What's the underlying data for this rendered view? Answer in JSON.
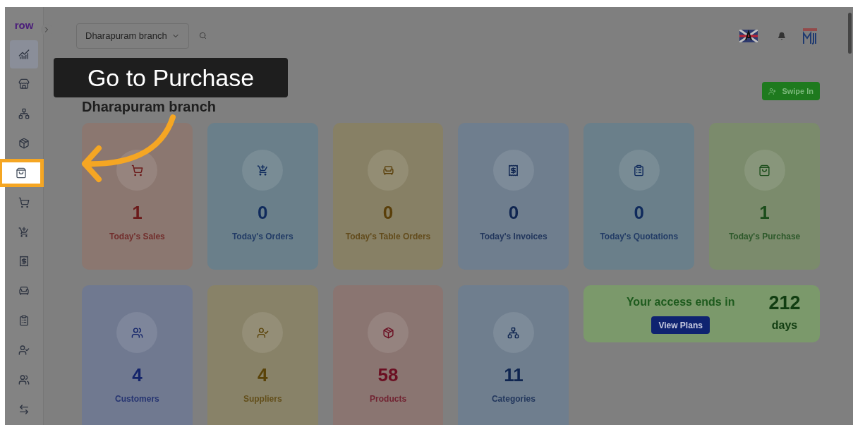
{
  "tooltip": {
    "text": "Go to Purchase"
  },
  "sidebar": {
    "logo": "row",
    "items": [
      {
        "kind": "chart",
        "selected": true,
        "highlighted": false
      },
      {
        "kind": "store",
        "selected": false,
        "highlighted": false
      },
      {
        "kind": "tree",
        "selected": false,
        "highlighted": false
      },
      {
        "kind": "box",
        "selected": false,
        "highlighted": false
      },
      {
        "kind": "bag",
        "selected": false,
        "highlighted": true
      },
      {
        "kind": "cart",
        "selected": false,
        "highlighted": false
      },
      {
        "kind": "cart-plus",
        "selected": false,
        "highlighted": false
      },
      {
        "kind": "receipt",
        "selected": false,
        "highlighted": false
      },
      {
        "kind": "table",
        "selected": false,
        "highlighted": false
      },
      {
        "kind": "list",
        "selected": false,
        "highlighted": false
      },
      {
        "kind": "supplier",
        "selected": false,
        "highlighted": false
      },
      {
        "kind": "users",
        "selected": false,
        "highlighted": false
      },
      {
        "kind": "transfer",
        "selected": false,
        "highlighted": false
      }
    ]
  },
  "header": {
    "branch_select": "Dharapuram branch"
  },
  "page": {
    "title": "Dharapuram branch",
    "swipe_button": "Swipe In"
  },
  "stats": [
    {
      "kind": "cart",
      "value": "1",
      "label": "Today's Sales",
      "color": "#6b1a1a"
    },
    {
      "kind": "cart-plus",
      "value": "0",
      "label": "Today's Orders",
      "color": "#0f2a5c"
    },
    {
      "kind": "table",
      "value": "0",
      "label": "Today's Table Orders",
      "color": "#5a3f0a"
    },
    {
      "kind": "receipt",
      "value": "0",
      "label": "Today's Invoices",
      "color": "#0f2550"
    },
    {
      "kind": "list",
      "value": "0",
      "label": "Today's Quotations",
      "color": "#0f2a5c"
    },
    {
      "kind": "bag",
      "value": "1",
      "label": "Today's Purchase",
      "color": "#1b4d1b"
    },
    {
      "kind": "users",
      "value": "4",
      "label": "Customers",
      "color": "#14246a"
    },
    {
      "kind": "supplier",
      "value": "4",
      "label": "Suppliers",
      "color": "#5a4308"
    },
    {
      "kind": "box",
      "value": "58",
      "label": "Products",
      "color": "#6b0f22"
    },
    {
      "kind": "tree",
      "value": "11",
      "label": "Categories",
      "color": "#0f2550"
    }
  ],
  "access": {
    "text": "Your access ends in",
    "button": "View Plans",
    "count": "212",
    "unit": "days"
  }
}
